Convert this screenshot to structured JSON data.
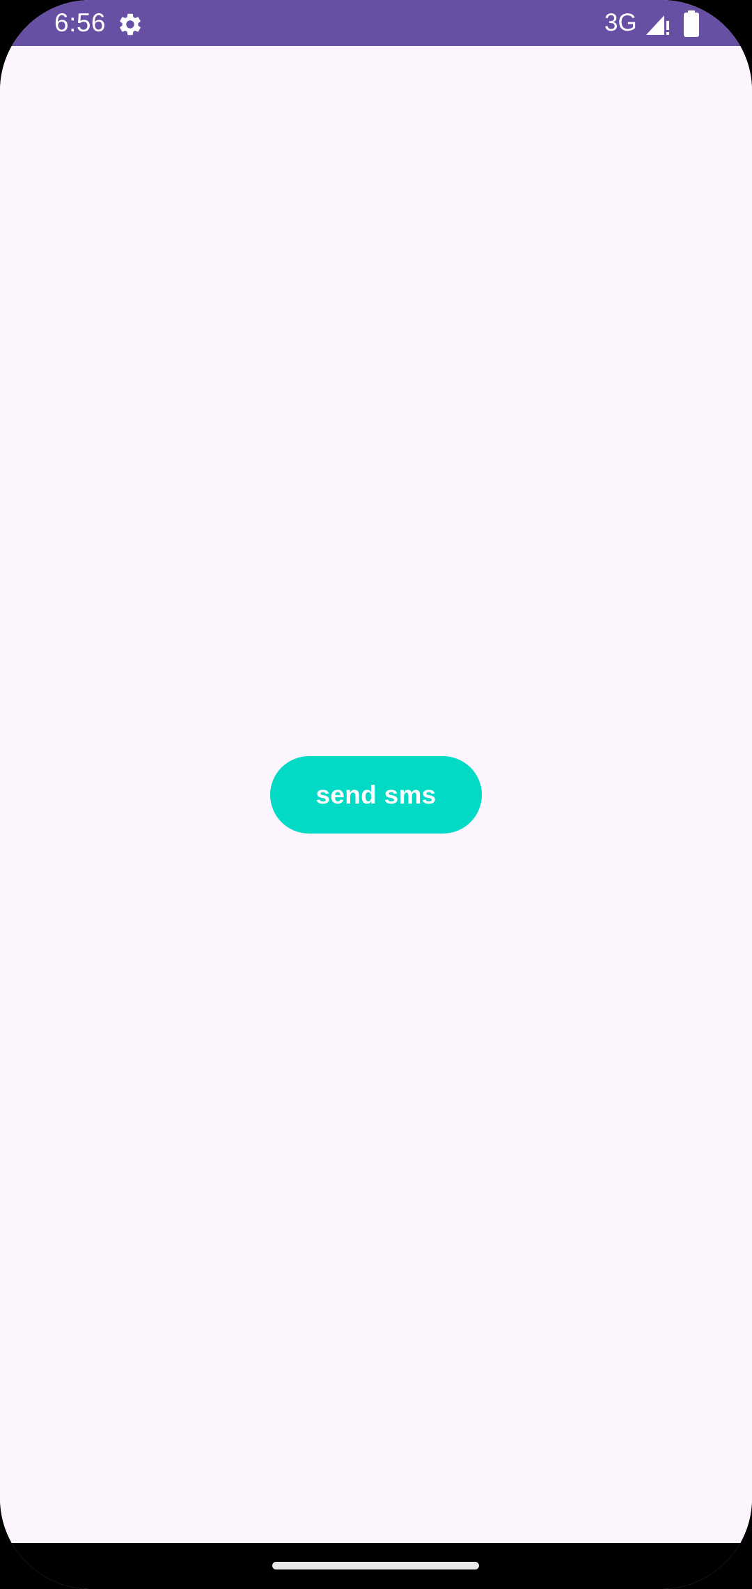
{
  "status_bar": {
    "time": "6:56",
    "network_type": "3G",
    "settings_icon": "gear-icon",
    "signal_icon": "signal-no-data-icon",
    "battery_icon": "battery-full-icon",
    "background_color": "#6750A4"
  },
  "main": {
    "send_button_label": "send sms",
    "send_button_color": "#03DAC5",
    "background_color": "#FDF5FE"
  },
  "navigation": {
    "home_indicator": "home-gesture-bar"
  }
}
